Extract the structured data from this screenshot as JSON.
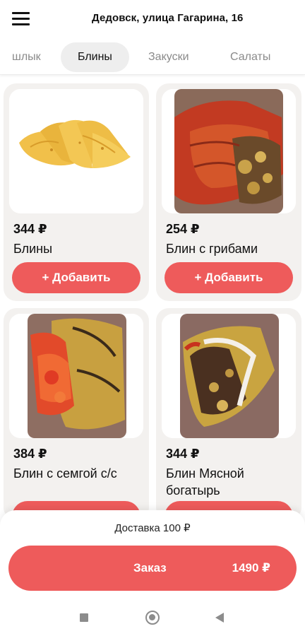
{
  "header": {
    "address": "Дедовск, улица Гагарина, 16"
  },
  "tabs": [
    {
      "label": "шлык",
      "active": false
    },
    {
      "label": "Блины",
      "active": true
    },
    {
      "label": "Закуски",
      "active": false
    },
    {
      "label": "Салаты",
      "active": false
    }
  ],
  "products": [
    {
      "price": "344 ₽",
      "name": "Блины",
      "add_label": "+ Добавить",
      "image": "folded-crepes"
    },
    {
      "price": "254 ₽",
      "name": "Блин с грибами",
      "add_label": "+ Добавить",
      "image": "crepe-with-mushrooms"
    },
    {
      "price": "384 ₽",
      "name": "Блин с семгой с/с",
      "add_label": "+ Добавить",
      "image": "crepe-with-salmon"
    },
    {
      "price": "344 ₽",
      "name": "Блин  Мясной богатырь",
      "add_label": "+ Добавить",
      "image": "crepe-with-meat"
    }
  ],
  "cart": {
    "delivery": "Доставка 100 ₽",
    "order_label": "Заказ",
    "total": "1490 ₽"
  },
  "colors": {
    "accent": "#ee5b5b",
    "card_bg": "#f3f1ef"
  },
  "system_nav": {
    "icons": [
      "recent-apps-icon",
      "home-icon",
      "back-icon"
    ]
  }
}
